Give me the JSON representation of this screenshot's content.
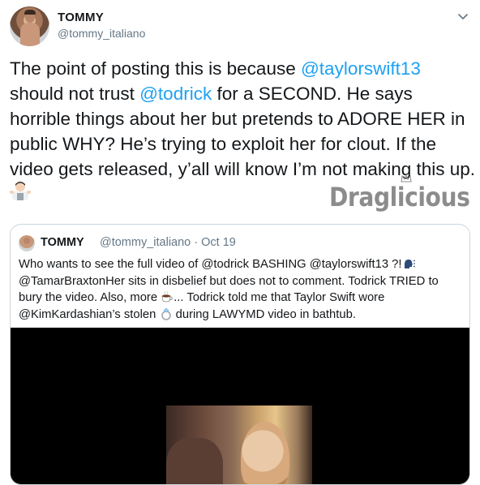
{
  "author": {
    "display_name": "TOMMY",
    "handle": "@tommy_italiano"
  },
  "tweet": {
    "lines": [
      {
        "pre": "The point of posting this is because ",
        "mention": "@taylorswift13",
        "post": ""
      },
      {
        "pre": " should not trust ",
        "mention": "@todrick",
        "post": " for a SECOND. He says"
      },
      {
        "pre": "horrible things about her but pretends to ADORE HER in",
        "mention": "",
        "post": ""
      },
      {
        "pre": "public WHY? He’s trying to exploit her for clout. If the",
        "mention": "",
        "post": ""
      },
      {
        "pre": "video gets released, y’all will know I’m not making this up.",
        "mention": "",
        "post": ""
      }
    ],
    "trailing_emoji_icon": "man-shrugging-icon"
  },
  "watermark": {
    "text": "Draglicious",
    "crown_icon": "crown-icon"
  },
  "quoted_tweet": {
    "display_name": "TOMMY",
    "handle_and_date": "@tommy_italiano · Oct 19",
    "lines": [
      {
        "text": "Who wants to see the full video of @todrick BASHING @taylorswift13 ?!",
        "emoji": "speaking-head-icon"
      },
      {
        "text": "@TamarBraxtonHer sits in disbelief but does not to comment. Todrick TRIED to",
        "emoji": ""
      },
      {
        "text_before": "bury the video. Also, more ",
        "emoji": "tea-cup-icon",
        "text_after": "... Todrick told me that Taylor Swift wore"
      },
      {
        "text_before": "@KimKardashian’s stolen ",
        "emoji": "ring-icon",
        "text_after": " during LAWYMD video in bathtub."
      }
    ],
    "media_type": "video"
  },
  "colors": {
    "link": "#1da1f2",
    "secondary_text": "#657786",
    "border": "#ccd6dd",
    "primary_text": "#14171a"
  }
}
